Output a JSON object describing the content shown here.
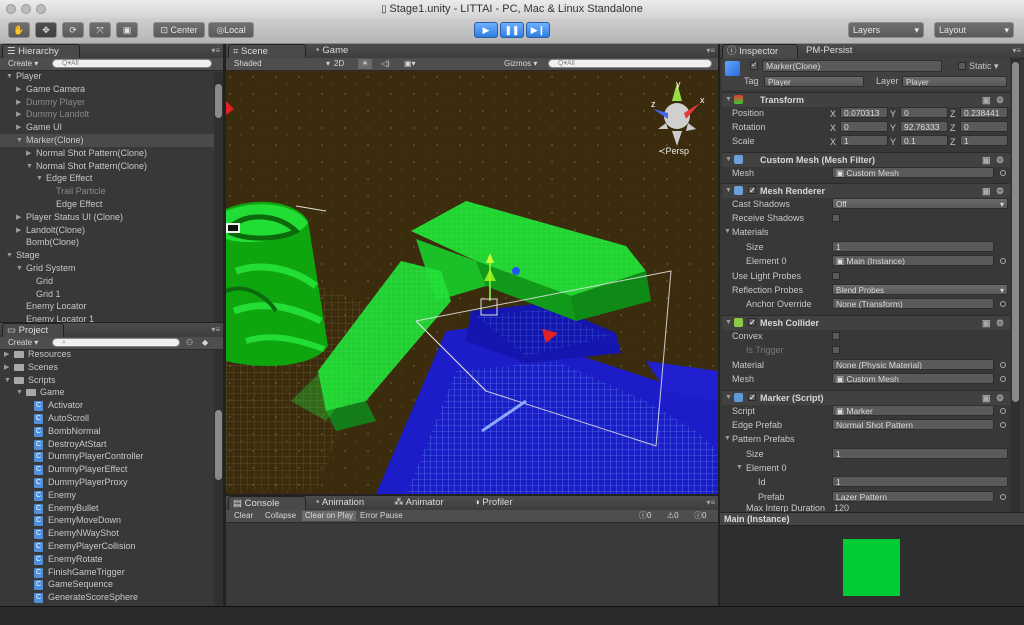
{
  "window": {
    "title": "Stage1.unity - LITTAI - PC, Mac & Linux Standalone"
  },
  "toolbar": {
    "tools": [
      "hand-tool",
      "move-tool",
      "rotate-tool",
      "scale-tool",
      "rect-tool"
    ],
    "pivot_label": "Center",
    "space_label": "Local",
    "layers_label": "Layers",
    "layout_label": "Layout"
  },
  "hierarchy": {
    "tab": "Hierarchy",
    "create_label": "Create",
    "search_placeholder": "Q▾All",
    "items": [
      {
        "label": "Player",
        "indent": 0,
        "arrow": "down"
      },
      {
        "label": "Game Camera",
        "indent": 1,
        "arrow": "right"
      },
      {
        "label": "Dummy Player",
        "indent": 1,
        "arrow": "right",
        "dim": true
      },
      {
        "label": "Dummy Landolt",
        "indent": 1,
        "arrow": "right",
        "dim": true
      },
      {
        "label": "Game UI",
        "indent": 1,
        "arrow": "right"
      },
      {
        "label": "Marker(Clone)",
        "indent": 1,
        "arrow": "down",
        "selected": true
      },
      {
        "label": "Normal Shot Pattern(Clone)",
        "indent": 2,
        "arrow": "right"
      },
      {
        "label": "Normal Shot Pattern(Clone)",
        "indent": 2,
        "arrow": "down"
      },
      {
        "label": "Edge Effect",
        "indent": 3,
        "arrow": "down"
      },
      {
        "label": "Trail Particle",
        "indent": 4,
        "arrow": "",
        "dim": true
      },
      {
        "label": "Edge Effect",
        "indent": 4,
        "arrow": ""
      },
      {
        "label": "Player Status UI (Clone)",
        "indent": 1,
        "arrow": "right"
      },
      {
        "label": "Landolt(Clone)",
        "indent": 1,
        "arrow": "right"
      },
      {
        "label": "Bomb(Clone)",
        "indent": 1,
        "arrow": ""
      },
      {
        "label": "Stage",
        "indent": 0,
        "arrow": "down"
      },
      {
        "label": "Grid System",
        "indent": 1,
        "arrow": "down"
      },
      {
        "label": "Grid",
        "indent": 2,
        "arrow": ""
      },
      {
        "label": "Grid 1",
        "indent": 2,
        "arrow": ""
      },
      {
        "label": "Enemy Locator",
        "indent": 1,
        "arrow": ""
      },
      {
        "label": "Enemy Locator 1",
        "indent": 1,
        "arrow": ""
      }
    ]
  },
  "project": {
    "tab": "Project",
    "create_label": "Create",
    "search_placeholder": "",
    "folders": [
      {
        "label": "Resources",
        "indent": 0,
        "arrow": "right"
      },
      {
        "label": "Scenes",
        "indent": 0,
        "arrow": "right"
      },
      {
        "label": "Scripts",
        "indent": 0,
        "arrow": "down"
      },
      {
        "label": "Game",
        "indent": 1,
        "arrow": "down"
      }
    ],
    "scripts": [
      "Activator",
      "AutoScroll",
      "BombNormal",
      "DestroyAtStart",
      "DummyPlayerController",
      "DummyPlayerEffect",
      "DummyPlayerProxy",
      "Enemy",
      "EnemyBullet",
      "EnemyMoveDown",
      "EnemyNWayShot",
      "EnemyPlayerCollision",
      "EnemyRotate",
      "FinishGameTrigger",
      "GameSequence",
      "GenerateScoreSphere"
    ]
  },
  "scene": {
    "tabs": [
      "Scene",
      "Game"
    ],
    "shading_mode": "Shaded",
    "mode_2d": "2D",
    "gizmos_label": "Gizmos",
    "search_placeholder": "Q▾All",
    "persp_label": "≺Persp",
    "axis_x": "x",
    "axis_y": "y",
    "axis_z": "z"
  },
  "console": {
    "tabs": [
      "Console",
      "Animation",
      "Animator",
      "Profiler"
    ],
    "buttons": [
      "Clear",
      "Collapse",
      "Clear on Play",
      "Error Pause"
    ],
    "counts": [
      "0",
      "0",
      "0"
    ]
  },
  "inspector": {
    "tabs": [
      "Inspector",
      "PM-Persist"
    ],
    "object_name": "Marker(Clone)",
    "static_label": "Static",
    "tag_label": "Tag",
    "tag_value": "Player",
    "layer_label": "Layer",
    "layer_value": "Player",
    "transform": {
      "title": "Transform",
      "position_label": "Position",
      "position": [
        "0.070313",
        "0",
        "0.238441"
      ],
      "rotation_label": "Rotation",
      "rotation": [
        "0",
        "92.76333",
        "0"
      ],
      "scale_label": "Scale",
      "scale": [
        "1",
        "0.1",
        "1"
      ],
      "axes": [
        "X",
        "Y",
        "Z"
      ]
    },
    "mesh_filter": {
      "title": "Custom Mesh (Mesh Filter)",
      "mesh_label": "Mesh",
      "mesh_value": "Custom Mesh"
    },
    "mesh_renderer": {
      "title": "Mesh Renderer",
      "cast_shadows_label": "Cast Shadows",
      "cast_shadows_value": "Off",
      "receive_shadows_label": "Receive Shadows",
      "materials_label": "Materials",
      "size_label": "Size",
      "size_value": "1",
      "element0_label": "Element 0",
      "element0_value": "Main (Instance)",
      "light_probes_label": "Use Light Probes",
      "reflection_probes_label": "Reflection Probes",
      "reflection_probes_value": "Blend Probes",
      "anchor_override_label": "Anchor Override",
      "anchor_override_value": "None (Transform)"
    },
    "mesh_collider": {
      "title": "Mesh Collider",
      "convex_label": "Convex",
      "trigger_label": "Is Trigger",
      "material_label": "Material",
      "material_value": "None (Physic Material)",
      "mesh_label": "Mesh",
      "mesh_value": "Custom Mesh"
    },
    "marker_script": {
      "title": "Marker (Script)",
      "script_label": "Script",
      "script_value": "Marker",
      "edge_prefab_label": "Edge Prefab",
      "edge_prefab_value": "Normal Shot Pattern",
      "pattern_prefabs_label": "Pattern Prefabs",
      "size_label": "Size",
      "size_value": "1",
      "element0_label": "Element 0",
      "id_label": "Id",
      "id_value": "1",
      "prefab_label": "Prefab",
      "prefab_value": "Lazer Pattern",
      "max_interp_label": "Max Interp Duration",
      "max_interp_value": "120"
    },
    "preview": {
      "title": "Main (Instance)",
      "color": "#00cc33"
    }
  },
  "colors": {
    "mesh_green": "#22dd33",
    "grid_blue": "#1a1acc",
    "scene_bg": "#3a2a10"
  }
}
